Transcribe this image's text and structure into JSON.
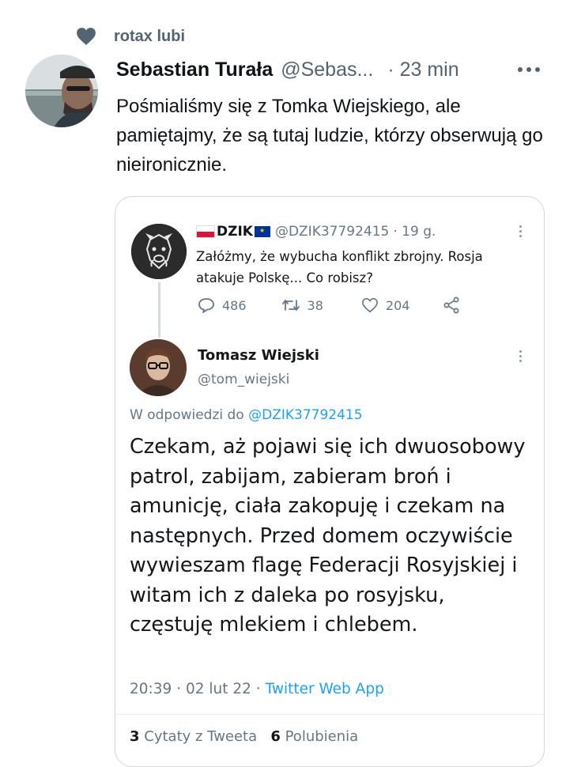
{
  "social_context": {
    "text": "rotax lubi",
    "icon": "heart-icon"
  },
  "tweet": {
    "author_name": "Sebastian Turała",
    "author_handle": "@Sebas...",
    "time": "· 23 min",
    "text": "Pośmialiśmy się z Tomka Wiejskiego, ale pamiętajmy, że są tutaj ludzie, którzy obserwują go nieironicznie."
  },
  "embedded": {
    "quoted": {
      "name": "DZIK",
      "handle": "@DZIK37792415",
      "time": "· 19 g.",
      "text": "Załóżmy, że wybucha konflikt zbrojny. Rosja atakuje Polskę... Co robisz?",
      "replies": "486",
      "retweets": "38",
      "likes": "204"
    },
    "reply": {
      "name": "Tomasz Wiejski",
      "handle": "@tom_wiejski",
      "in_reply_prefix": "W odpowiedzi do",
      "in_reply_handle": "@DZIK37792415",
      "text": "Czekam, aż pojawi się ich dwuosobowy patrol, zabijam, zabieram broń i amunicję, ciała zakopuję i czekam na następnych. Przed domem oczywiście wywieszam flagę Federacji Rosyjskiej i witam ich z daleka po rosyjsku, częstuję mlekiem i chlebem.",
      "timestamp": "20:39 · 02 lut 22 ·",
      "app": "Twitter Web App",
      "quotes_count": "3",
      "quotes_label": "Cytaty z Tweeta",
      "likes_count": "6",
      "likes_label": "Polubienia"
    }
  }
}
